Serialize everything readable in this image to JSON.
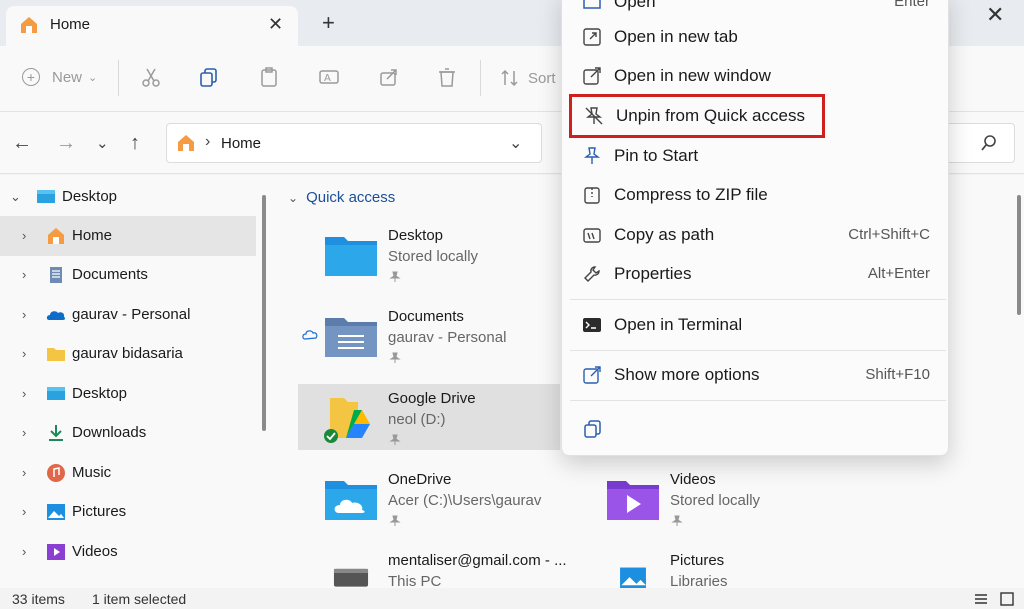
{
  "window": {
    "tab_label": "Home",
    "tab_close": "✕",
    "new_tab": "+",
    "close": "✕"
  },
  "toolbar": {
    "new_label": "New",
    "sort_label": "Sort"
  },
  "address": {
    "path_text": "Home",
    "separator": "›"
  },
  "sidebar": {
    "items": [
      {
        "label": "Desktop",
        "icon": "desktop-icon"
      },
      {
        "label": "Home",
        "icon": "home-icon",
        "selected": true
      },
      {
        "label": "Documents",
        "icon": "documents-icon"
      },
      {
        "label": "gaurav - Personal",
        "icon": "onedrive-icon"
      },
      {
        "label": "gaurav bidasaria",
        "icon": "folder-icon"
      },
      {
        "label": "Desktop",
        "icon": "desktop-icon"
      },
      {
        "label": "Downloads",
        "icon": "downloads-icon"
      },
      {
        "label": "Music",
        "icon": "music-icon"
      },
      {
        "label": "Pictures",
        "icon": "pictures-icon"
      },
      {
        "label": "Videos",
        "icon": "videos-icon"
      }
    ]
  },
  "main": {
    "section_title": "Quick access",
    "tiles": [
      {
        "name": "Desktop",
        "sub": "Stored locally"
      },
      {
        "name": "Documents",
        "sub": "gaurav - Personal"
      },
      {
        "name": "Google Drive",
        "sub": "neol (D:)"
      },
      {
        "name": "OneDrive",
        "sub": "Acer (C:)\\Users\\gaurav"
      },
      {
        "name": "Videos",
        "sub": "Stored locally"
      },
      {
        "name": "mentaliser@gmail.com - ...",
        "sub": "This PC"
      },
      {
        "name": "Pictures",
        "sub": "Libraries"
      }
    ]
  },
  "status": {
    "items_count": "33 items",
    "selected": "1 item selected"
  },
  "context_menu": {
    "items": [
      {
        "label": "Open",
        "shortcut": "Enter"
      },
      {
        "label": "Open in new tab",
        "shortcut": ""
      },
      {
        "label": "Open in new window",
        "shortcut": ""
      },
      {
        "label": "Unpin from Quick access",
        "shortcut": "",
        "highlighted": true
      },
      {
        "label": "Pin to Start",
        "shortcut": ""
      },
      {
        "label": "Compress to ZIP file",
        "shortcut": ""
      },
      {
        "label": "Copy as path",
        "shortcut": "Ctrl+Shift+C"
      },
      {
        "label": "Properties",
        "shortcut": "Alt+Enter"
      },
      {
        "label": "Open in Terminal",
        "shortcut": ""
      },
      {
        "label": "Show more options",
        "shortcut": "Shift+F10"
      }
    ],
    "highlight_color": "#d01f1f"
  },
  "colors": {
    "accent": "#1b4f9a",
    "folder_blue": "#1f8fe0",
    "folder_yellow": "#f4c542"
  }
}
